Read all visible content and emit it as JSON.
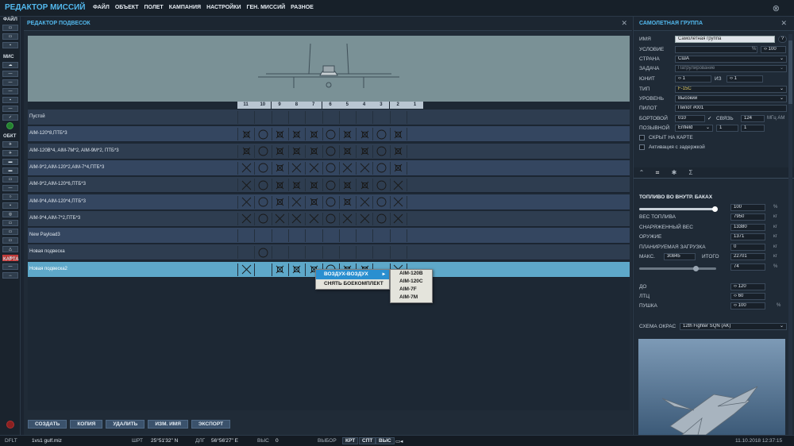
{
  "app": {
    "title": "РЕДАКТОР МИССИЙ"
  },
  "menu": [
    "ФАЙЛ",
    "ОБЪЕКТ",
    "ПОЛЕТ",
    "КАМПАНИЯ",
    "НАСТРОЙКИ",
    "ГЕН. МИССИЙ",
    "РАЗНОЕ"
  ],
  "toolbar": {
    "file_label": "ФАЙЛ",
    "mis_label": "МИС",
    "obj_label": "ОБКТ",
    "map_label": "КАРТА"
  },
  "payload_editor": {
    "title": "РЕДАКТОР ПОДВЕСОК",
    "columns": [
      "11",
      "10",
      "9",
      "8",
      "7",
      "6",
      "5",
      "4",
      "3",
      "2",
      "1"
    ],
    "rows": [
      {
        "name": "Пустой",
        "cells": [
          "",
          "",
          "",
          "",
          "",
          "",
          "",
          "",
          "",
          "",
          ""
        ]
      },
      {
        "name": "AIM-120*8,ПТБ*3",
        "cells": [
          "x",
          "o",
          "x",
          "x",
          "x",
          "o",
          "x",
          "x",
          "o",
          "x",
          ""
        ]
      },
      {
        "name": "AIM-120B*4, AIM-7M*2, AIM-9M*2, ПТБ*3",
        "cells": [
          "x",
          "o",
          "x",
          "x",
          "x",
          "o",
          "x",
          "x",
          "o",
          "x",
          ""
        ]
      },
      {
        "name": "AIM-9*2,AIM-120*2,AIM-7*4,ПТБ*3",
        "cells": [
          "X",
          "o",
          "x",
          "X",
          "X",
          "o",
          "X",
          "X",
          "o",
          "x",
          ""
        ]
      },
      {
        "name": "AIM-9*2,AIM-120*6,ПТБ*3",
        "cells": [
          "X",
          "o",
          "x",
          "x",
          "x",
          "o",
          "x",
          "x",
          "o",
          "X",
          ""
        ]
      },
      {
        "name": "AIM-9*4,AIM-120*4,ПТБ*3",
        "cells": [
          "X",
          "o",
          "x",
          "X",
          "x",
          "o",
          "x",
          "X",
          "o",
          "X",
          ""
        ]
      },
      {
        "name": "AIM-9*4,AIM-7*2,ПТБ*3",
        "cells": [
          "X",
          "o",
          "X",
          "X",
          "X",
          "o",
          "X",
          "X",
          "o",
          "X",
          ""
        ]
      },
      {
        "name": "New Payload3",
        "cells": [
          "",
          "",
          "",
          "",
          "",
          "",
          "",
          "",
          "",
          "",
          ""
        ]
      },
      {
        "name": "Новая подвеска",
        "cells": [
          "",
          "o",
          "",
          "",
          "",
          "",
          "",
          "",
          "",
          "",
          ""
        ]
      },
      {
        "name": "Новая подвеска2",
        "cells": [
          "X",
          "",
          "x",
          "x",
          "x",
          "o",
          "x",
          "x",
          "",
          "X",
          ""
        ]
      }
    ],
    "buttons": [
      "СОЗДАТЬ",
      "КОПИЯ",
      "УДАЛИТЬ",
      "ИЗМ. ИМЯ",
      "ЭКСПОРТ"
    ]
  },
  "context_menu": {
    "items": [
      "ВОЗДУХ-ВОЗДУХ",
      "СНЯТЬ БОЕКОМПЛЕКТ"
    ],
    "submenu": [
      "AIM-120B",
      "AIM-120C",
      "AIM-7F",
      "AIM-7M"
    ]
  },
  "group": {
    "title": "САМОЛЕТНАЯ ГРУППА",
    "name_label": "ИМЯ",
    "name_value": "Самолетная группа",
    "condition_label": "УСЛОВИЕ",
    "condition_percent": "%",
    "condition_value": "100",
    "country_label": "СТРАНА",
    "country_value": "США",
    "task_label": "ЗАДАЧА",
    "task_value": "Патрулирование",
    "unit_label": "ЮНИТ",
    "unit_value": "1",
    "of_label": "ИЗ",
    "of_value": "1",
    "type_label": "ТИП",
    "type_value": "F-15C",
    "level_label": "УРОВЕНЬ",
    "level_value": "Высокий",
    "pilot_label": "ПИЛОТ",
    "pilot_value": "Пилот #001",
    "board_label": "БОРТОВОЙ",
    "board_value": "010",
    "comm_label": "СВЯЗЬ",
    "comm_value": "124",
    "comm_unit": "МГц AM",
    "callsign_label": "ПОЗЫВНОЙ",
    "callsign_value": "Enfield",
    "callsign_n1": "1",
    "callsign_n2": "1",
    "hidden_label": "СКРЫТ НА КАРТЕ",
    "late_label": "Активация с задержкой"
  },
  "fuel": {
    "title": "ТОПЛИВО ВО ВНУТР. БАКАХ",
    "percent": "100",
    "percent_unit": "%",
    "fuel_weight_label": "ВЕС ТОПЛИВА",
    "fuel_weight": "7950",
    "kg": "кг",
    "equip_weight_label": "СНАРЯЖЕННЫЙ ВЕС",
    "equip_weight": "13380",
    "weapon_label": "ОРУЖИЕ",
    "weapon": "1371",
    "planned_label": "ПЛАНИРУЕМАЯ ЗАГРУЗКА",
    "planned": "0",
    "max_label": "МАКС.",
    "max": "30845",
    "total_label": "ИТОГО",
    "total": "22701",
    "load_percent": "74",
    "chaff_label": "ДО",
    "chaff": "120",
    "flare_label": "ЛТЦ",
    "flare": "60",
    "gun_label": "ПУШКА",
    "gun": "100"
  },
  "livery": {
    "label": "СХЕМА ОКРАС",
    "value": "12th Fighter SQN (AK)"
  },
  "status": {
    "mode": "DFLT",
    "file": "1vs1 gulf.miz",
    "lat_label": "ШРТ",
    "lat": "25°51'32\" N",
    "lon_label": "ДЛГ",
    "lon": "56°56'27\" E",
    "alt_label": "ВЫС",
    "alt": "0",
    "select_label": "ВЫБОР",
    "btn1": "КРТ",
    "btn2": "СПТ",
    "btn3": "ВЫС",
    "datetime": "11.10.2018 12:37:15"
  },
  "colors": {
    "accent": "#53b9ee",
    "selected_row": "#5ea8c9",
    "menu_highlight": "#2a8fd0"
  }
}
